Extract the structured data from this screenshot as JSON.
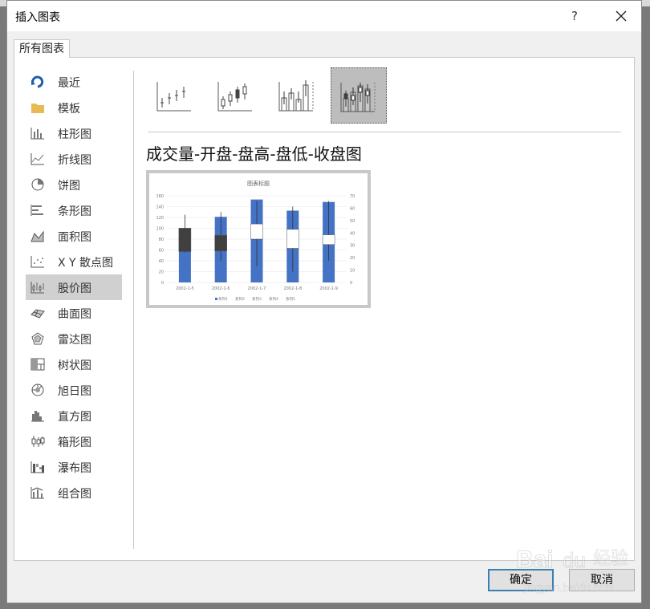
{
  "dialog": {
    "title": "插入图表",
    "help_label": "?"
  },
  "tab": {
    "label": "所有图表"
  },
  "categories": [
    {
      "label": "最近",
      "icon": "recent-icon"
    },
    {
      "label": "模板",
      "icon": "folder-icon"
    },
    {
      "label": "柱形图",
      "icon": "column-chart-icon"
    },
    {
      "label": "折线图",
      "icon": "line-chart-icon"
    },
    {
      "label": "饼图",
      "icon": "pie-chart-icon"
    },
    {
      "label": "条形图",
      "icon": "bar-chart-icon"
    },
    {
      "label": "面积图",
      "icon": "area-chart-icon"
    },
    {
      "label": "X Y 散点图",
      "icon": "scatter-chart-icon"
    },
    {
      "label": "股价图",
      "icon": "stock-chart-icon"
    },
    {
      "label": "曲面图",
      "icon": "surface-chart-icon"
    },
    {
      "label": "雷达图",
      "icon": "radar-chart-icon"
    },
    {
      "label": "树状图",
      "icon": "treemap-chart-icon"
    },
    {
      "label": "旭日图",
      "icon": "sunburst-chart-icon"
    },
    {
      "label": "直方图",
      "icon": "histogram-chart-icon"
    },
    {
      "label": "箱形图",
      "icon": "box-whisker-chart-icon"
    },
    {
      "label": "瀑布图",
      "icon": "waterfall-chart-icon"
    },
    {
      "label": "组合图",
      "icon": "combo-chart-icon"
    }
  ],
  "selected_category": "股价图",
  "subtypes": [
    "high-low-close",
    "open-high-low-close",
    "volume-high-low-close",
    "volume-open-high-low-close"
  ],
  "selected_subtype_title": "成交量-开盘-盘高-盘低-收盘图",
  "buttons": {
    "ok": "确定",
    "cancel": "取消"
  },
  "watermark": {
    "text": "Bai 经验",
    "url": "jingyan.baidu.com"
  },
  "chart_data": {
    "type": "bar",
    "title": "图表标题",
    "categories": [
      "2002-1-5",
      "2002-1-6",
      "2002-1-7",
      "2002-1-8",
      "2002-1-9"
    ],
    "left_axis": {
      "ticks": [
        0,
        20,
        40,
        60,
        80,
        100,
        120,
        140,
        160
      ],
      "ylim": [
        0,
        160
      ]
    },
    "right_axis": {
      "ticks": [
        0,
        10,
        20,
        30,
        40,
        50,
        60,
        70
      ],
      "ylim": [
        0,
        70
      ]
    },
    "volume": [
      44,
      53,
      67,
      58,
      65
    ],
    "open": [
      100,
      87,
      80,
      63,
      70
    ],
    "high": [
      125,
      130,
      150,
      140,
      150
    ],
    "low": [
      55,
      40,
      30,
      20,
      40
    ],
    "close": [
      57,
      58,
      108,
      98,
      88
    ],
    "legend": [
      "系列1",
      "系列2",
      "系列3",
      "系列4",
      "系列5"
    ],
    "colors": {
      "volume": "#4472c4",
      "up": "#ffffff",
      "down": "#404040"
    },
    "grid": true,
    "legend_position": "bottom"
  }
}
